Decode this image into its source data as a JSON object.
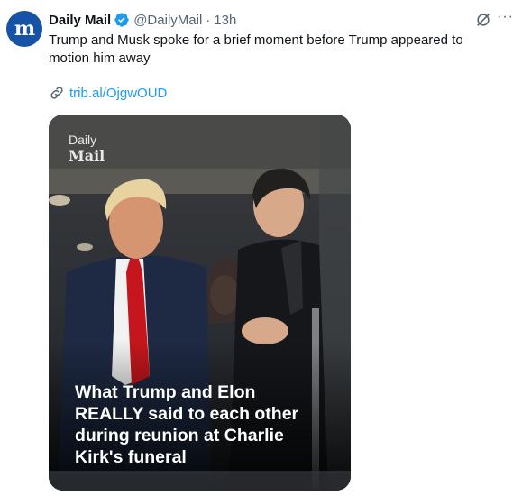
{
  "author": {
    "avatar_letter": "m",
    "name": "Daily Mail",
    "handle": "@DailyMail",
    "separator": "·",
    "time": "13h"
  },
  "icons": {
    "verified": "verified-badge-icon",
    "grok": "grok-icon",
    "more": "more-icon",
    "link": "link-icon"
  },
  "actions": {
    "more_label": "···"
  },
  "tweet": {
    "text": "Trump and Musk spoke for a brief moment before Trump appeared to\nmotion him away",
    "link": "trib.al/OjgwOUD"
  },
  "media": {
    "logo_line1": "Daily",
    "logo_line2": "Mail",
    "caption": "What Trump and Elon\nREALLY said to each other\nduring reunion at Charlie\nKirk's funeral"
  },
  "colors": {
    "accent": "#1d9bf0",
    "avatar_bg": "#1652a6",
    "tie": "#c4161c"
  }
}
